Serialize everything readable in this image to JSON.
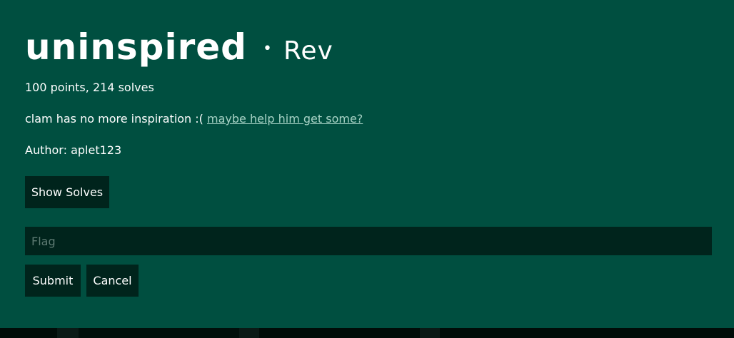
{
  "challenge": {
    "title": "uninspired",
    "separator": "•",
    "category": "Rev",
    "stats": "100 points, 214 solves",
    "description_text": "clam has no more inspiration :(",
    "description_link": "maybe help him get some?",
    "author": "Author: aplet123"
  },
  "buttons": {
    "show_solves": "Show Solves",
    "submit": "Submit",
    "cancel": "Cancel"
  },
  "flag_input": {
    "placeholder": "Flag",
    "value": ""
  },
  "colors": {
    "modal_bg": "#004f40",
    "button_bg": "#00241c",
    "link": "#a8d3c6"
  }
}
